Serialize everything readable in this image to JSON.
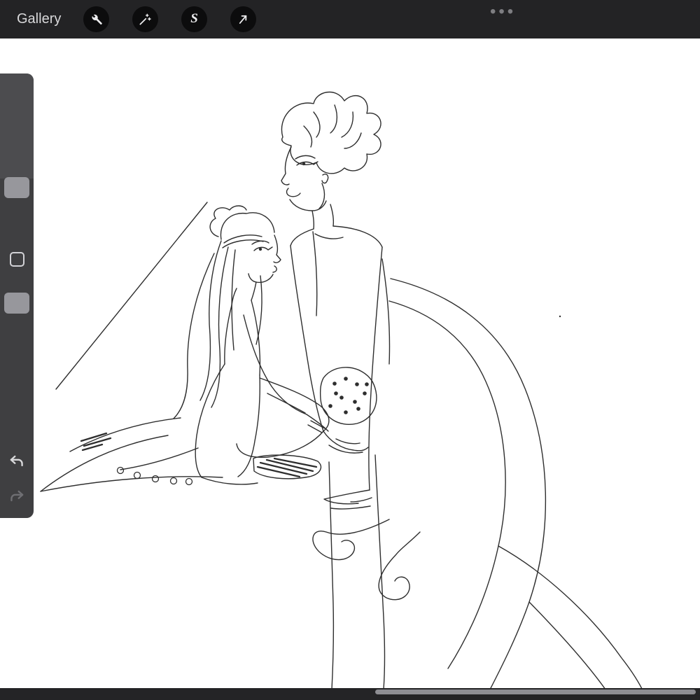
{
  "toolbar": {
    "gallery_label": "Gallery",
    "selection_glyph": "S",
    "overflow_label": "•••",
    "tools": [
      {
        "id": "actions",
        "icon": "wrench-icon"
      },
      {
        "id": "adjustments",
        "icon": "magic-wand-icon"
      },
      {
        "id": "selection",
        "icon": "selection-s-icon"
      },
      {
        "id": "transform",
        "icon": "transform-arrow-icon"
      }
    ]
  },
  "sidebar": {
    "controls": [
      "brush-size-slider",
      "modify-button",
      "brush-opacity-slider",
      "undo-button",
      "redo-button"
    ],
    "icons": [
      "brush-size-handle",
      "modify-square-icon",
      "brush-opacity-handle",
      "undo-arrow-icon",
      "redo-arrow-icon"
    ]
  },
  "canvas": {
    "description": "Line-art pencil sketch: a long-haired girl in a buttoned coat sits cross-legged on a blanket looking up at a standing tousle-haired figure whose lower body trails into a long serpentine tail with curling tentacles; a leopard-spotted cloth rests between them; a diagonal wall line crosses the upper left."
  },
  "colors": {
    "topbar": "#232325",
    "tool_circle": "#0c0c0d",
    "icon": "#ededef",
    "canvas": "#ffffff",
    "sidebar": "#3f3f41",
    "slider_handle": "#97979c",
    "sketch_stroke": "#2e2e2e",
    "bottom_bar": "#242426",
    "scrollbar": "#8e8e93"
  }
}
